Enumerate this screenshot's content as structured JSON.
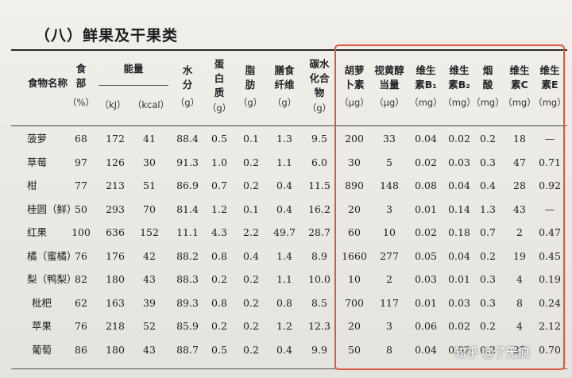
{
  "section_title": "（八）鲜果及干果类",
  "headers": {
    "food_name": "食物名称",
    "edible": "食\n部",
    "edible_unit": "（%）",
    "energy": "能量",
    "energy_kj": "（kJ）",
    "energy_kcal": "（kcal）",
    "water": "水\n分",
    "water_unit": "（g）",
    "protein": "蛋\n白\n质",
    "protein_unit": "（g）",
    "fat": "脂\n肪",
    "fat_unit": "（g）",
    "fiber": "膳食\n纤维",
    "fiber_unit": "（g）",
    "carb": "碳水\n化合\n物",
    "carb_unit": "（g）",
    "carotene": "胡萝\n卜素",
    "carotene_unit": "（μg）",
    "retinol": "视黄醇\n当量",
    "retinol_unit": "（μg）",
    "vb1": "维生\n素B₁",
    "vb1_unit": "（mg）",
    "vb2": "维生\n素B₂",
    "vb2_unit": "（mg）",
    "niacin": "烟\n酸",
    "niacin_unit": "（mg）",
    "vc": "维生\n素C",
    "vc_unit": "（mg）",
    "ve": "维生\n素E",
    "ve_unit": "（mg）"
  },
  "rows": [
    {
      "name": "菠萝",
      "v": [
        "68",
        "172",
        "41",
        "88.4",
        "0.5",
        "0.1",
        "1.3",
        "9.5",
        "200",
        "33",
        "0.04",
        "0.02",
        "0.2",
        "18",
        "—"
      ]
    },
    {
      "name": "草莓",
      "v": [
        "97",
        "126",
        "30",
        "91.3",
        "1.0",
        "0.2",
        "1.1",
        "6.0",
        "30",
        "5",
        "0.02",
        "0.03",
        "0.3",
        "47",
        "0.71"
      ]
    },
    {
      "name": "柑",
      "v": [
        "77",
        "213",
        "51",
        "86.9",
        "0.7",
        "0.2",
        "0.4",
        "11.5",
        "890",
        "148",
        "0.08",
        "0.04",
        "0.4",
        "28",
        "0.92"
      ]
    },
    {
      "name": "桂圆（鲜）",
      "v": [
        "50",
        "293",
        "70",
        "81.4",
        "1.2",
        "0.1",
        "0.4",
        "16.2",
        "20",
        "3",
        "0.01",
        "0.14",
        "1.3",
        "43",
        "—"
      ]
    },
    {
      "name": "红果",
      "v": [
        "100",
        "636",
        "152",
        "11.1",
        "4.3",
        "2.2",
        "49.7",
        "28.7",
        "60",
        "10",
        "0.02",
        "0.18",
        "0.7",
        "2",
        "0.47"
      ]
    },
    {
      "name": "橘（蜜橘）",
      "v": [
        "76",
        "176",
        "42",
        "88.2",
        "0.8",
        "0.4",
        "1.4",
        "8.9",
        "1660",
        "277",
        "0.05",
        "0.04",
        "0.2",
        "19",
        "0.45"
      ]
    },
    {
      "name": "梨（鸭梨）",
      "v": [
        "82",
        "180",
        "43",
        "88.3",
        "0.2",
        "0.2",
        "1.1",
        "10.0",
        "10",
        "2",
        "0.03",
        "0.01",
        "0.3",
        "4",
        "0.19"
      ]
    },
    {
      "name": "枇杷",
      "v": [
        "62",
        "163",
        "39",
        "89.3",
        "0.8",
        "0.2",
        "0.8",
        "8.5",
        "700",
        "117",
        "0.01",
        "0.03",
        "0.3",
        "8",
        "0.24"
      ]
    },
    {
      "name": "苹果",
      "v": [
        "76",
        "218",
        "52",
        "85.9",
        "0.2",
        "0.2",
        "1.2",
        "12.3",
        "20",
        "3",
        "0.06",
        "0.02",
        "0.2",
        "4",
        "2.12"
      ]
    },
    {
      "name": "葡萄",
      "v": [
        "86",
        "180",
        "43",
        "88.7",
        "0.5",
        "0.2",
        "0.4",
        "9.9",
        "50",
        "8",
        "0.04",
        "0.02",
        "0.2",
        "25",
        "0.70"
      ]
    }
  ],
  "watermark": "知乎 @了无痕",
  "highlight_color": "#e0563f"
}
